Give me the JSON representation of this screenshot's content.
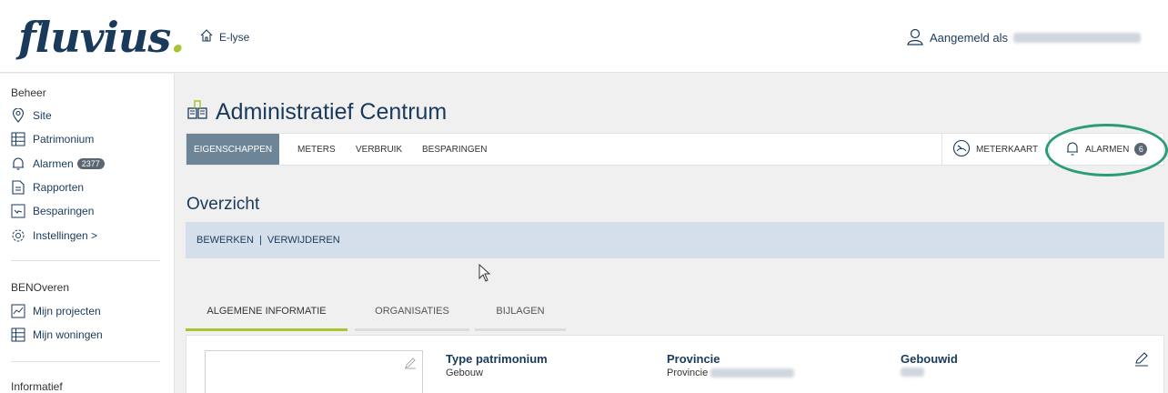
{
  "header": {
    "logo_text": "fluvius",
    "logo_dot": ".",
    "app_name": "E-lyse",
    "user_label": "Aangemeld als"
  },
  "sidebar": {
    "sections": [
      {
        "title": "Beheer",
        "items": [
          {
            "label": "Site",
            "icon": "location-pin-icon"
          },
          {
            "label": "Patrimonium",
            "icon": "list-grid-icon"
          },
          {
            "label": "Alarmen",
            "icon": "bell-icon",
            "badge": "2377"
          },
          {
            "label": "Rapporten",
            "icon": "document-icon"
          },
          {
            "label": "Besparingen",
            "icon": "savings-icon"
          },
          {
            "label": "Instellingen >",
            "icon": "gear-icon"
          }
        ]
      },
      {
        "title": "BENOveren",
        "items": [
          {
            "label": "Mijn projecten",
            "icon": "chart-icon"
          },
          {
            "label": "Mijn woningen",
            "icon": "list-grid-icon"
          }
        ]
      },
      {
        "title": "Informatief",
        "items": []
      }
    ]
  },
  "page": {
    "title": "Administratief Centrum",
    "tabs": [
      "EIGENSCHAPPEN",
      "METERS",
      "VERBRUIK",
      "BESPARINGEN"
    ],
    "active_tab": "EIGENSCHAPPEN",
    "meterkaart_label": "METERKAART",
    "alarmen_label": "ALARMEN",
    "alarmen_count": "6"
  },
  "overzicht": {
    "title": "Overzicht",
    "edit_label": "BEWERKEN",
    "separator": "|",
    "delete_label": "VERWIJDEREN"
  },
  "subtabs": [
    "ALGEMENE INFORMATIE",
    "ORGANISATIES",
    "BIJLAGEN"
  ],
  "info": {
    "type_label": "Type patrimonium",
    "type_value": "Gebouw",
    "provincie_label": "Provincie",
    "provincie_value": "Provincie",
    "gebouwid_label": "Gebouwid"
  },
  "colors": {
    "brand_navy": "#1a3a5c",
    "brand_green": "#a6c531",
    "active_tab": "#6d8597",
    "highlight": "#2a9d78",
    "action_bar": "#d5dfec"
  }
}
